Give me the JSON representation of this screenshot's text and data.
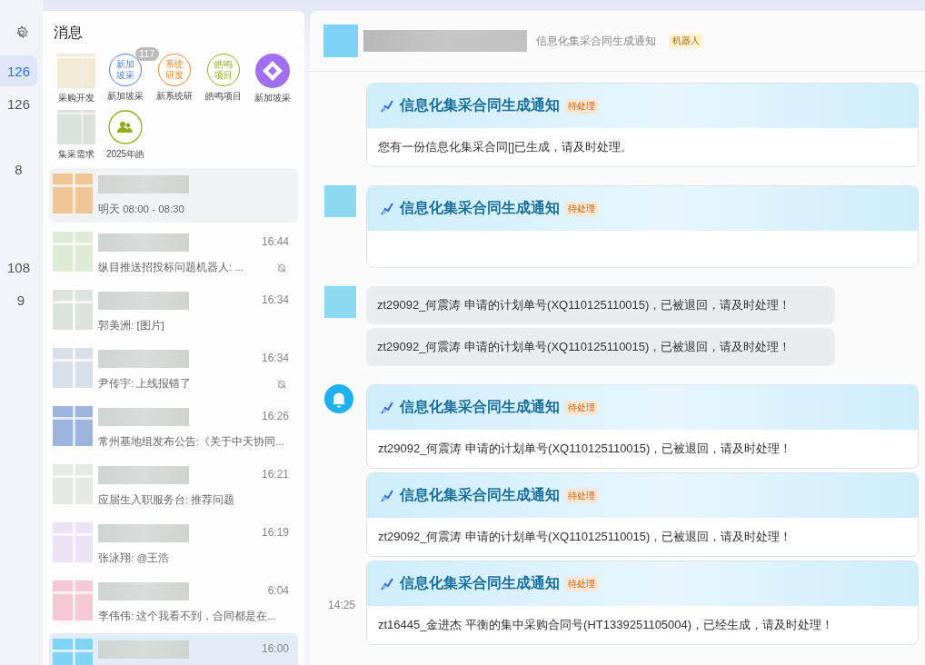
{
  "rail": {
    "items": [
      {
        "count": "126",
        "selected": true
      },
      {
        "count": "126",
        "selected": false
      },
      {
        "count": "8",
        "selected": false
      },
      {
        "count": "108",
        "selected": false
      },
      {
        "count": "9",
        "selected": false
      }
    ]
  },
  "panel": {
    "title": "消息",
    "shortcuts": [
      {
        "kind": "picture",
        "label": "采购开发",
        "color": "#f1ebd5"
      },
      {
        "kind": "text-circle",
        "text": "新加坡采",
        "label": "新加坡采",
        "color": "#4a7fe0",
        "badge": "117"
      },
      {
        "kind": "text-circle",
        "text": "系统研发",
        "label": "新系统研",
        "color": "#e0882a"
      },
      {
        "kind": "text-circle",
        "text": "皓鸣项目",
        "label": "皓鸣项目",
        "color": "#8fae1b"
      },
      {
        "kind": "logo",
        "label": "新加坡采",
        "color": "#a070f0"
      },
      {
        "kind": "picture",
        "label": "集采需求",
        "color": "#dbe2dc"
      },
      {
        "kind": "group",
        "label": "2025年皓",
        "color": "#8fae1b"
      }
    ],
    "chats": [
      {
        "color": "#f0c695",
        "preview": "明天 08:00 - 08:30",
        "muted": false,
        "selected": true
      },
      {
        "color": "#dfead7",
        "time": "16:44",
        "preview": "纵目推送招投标问题机器人: ...",
        "muted": true,
        "selected": false
      },
      {
        "color": "#dbe3dc",
        "time": "16:34",
        "preview": "郭美洲: [图片]",
        "muted": false,
        "selected": false
      },
      {
        "color": "#d9e0ea",
        "time": "16:34",
        "preview": "尹传宇: 上线报错了",
        "muted": true,
        "selected": false
      },
      {
        "color": "#9db4e0",
        "time": "16:26",
        "preview": "常州基地组发布公告:《关于中天协同...",
        "muted": false,
        "selected": false
      },
      {
        "color": "#e6e8e4",
        "time": "16:21",
        "preview": "应届生入职服务台: 推荐问题",
        "muted": false,
        "selected": false
      },
      {
        "color": "#ebe2f3",
        "time": "16:19",
        "preview": "张泳翔: @王浩",
        "muted": false,
        "selected": false
      },
      {
        "color": "#f3c9d4",
        "time": "6:04",
        "preview": "李伟伟: 这个我看不到，合同都是在...",
        "muted": false,
        "selected": false
      },
      {
        "color": "#7fd3f7",
        "time": "16:00",
        "muted": false,
        "selected": true
      }
    ]
  },
  "chat": {
    "header": {
      "subtitle": "信息化集采合同生成通知",
      "tag": "机器人"
    },
    "messages": [
      {
        "kind": "card",
        "title": "信息化集采合同生成通知",
        "status": "待处理",
        "body": "您有一份信息化集采合同[]已生成，请及时处理。"
      },
      {
        "avatar": {
          "kind": "square"
        },
        "kind": "card",
        "title": "信息化集采合同生成通知",
        "status": "待处理"
      },
      {
        "avatar": {
          "kind": "square"
        },
        "kind": "bubble",
        "body": "zt29092_何震涛 申请的计划单号(XQ110125110015)，已被退回，请及时处理！"
      },
      {
        "kind": "bubble",
        "body": "zt29092_何震涛 申请的计划单号(XQ110125110015)，已被退回，请及时处理！"
      },
      {
        "avatar": {
          "kind": "bell"
        },
        "kind": "card",
        "title": "信息化集采合同生成通知",
        "status": "待处理",
        "body": "zt29092_何震涛 申请的计划单号(XQ110125110015)，已被退回，请及时处理！"
      },
      {
        "kind": "card",
        "title": "信息化集采合同生成通知",
        "status": "待处理",
        "body": "zt29092_何震涛 申请的计划单号(XQ110125110015)，已被退回，请及时处理！"
      },
      {
        "time": "14:25",
        "kind": "card",
        "title": "信息化集采合同生成通知",
        "status": "待处理",
        "body": "zt16445_金进杰 平衡的集中采购合同号(HT1339251105004)，已经生成，请及时处理！"
      }
    ]
  }
}
